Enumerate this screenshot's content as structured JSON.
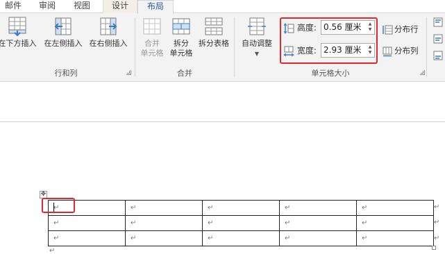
{
  "tabs": [
    {
      "label": "邮件"
    },
    {
      "label": "审阅"
    },
    {
      "label": "视图"
    },
    {
      "label": "设计"
    },
    {
      "label": "布局"
    }
  ],
  "ribbon": {
    "rows_cols": {
      "label": "行和列",
      "insert_below": "在下方插入",
      "insert_left": "在左侧插入",
      "insert_right": "在右侧插入"
    },
    "merge": {
      "label": "合并",
      "merge_cells": [
        "合并",
        "单元格"
      ],
      "split_cells": [
        "拆分",
        "单元格"
      ],
      "split_table": "拆分表格"
    },
    "cell_size": {
      "label": "单元格大小",
      "autofit": "自动调整",
      "height_label": "高度:",
      "height_value": "0.56 厘米",
      "width_label": "宽度:",
      "width_value": "2.93 厘米",
      "distribute_rows": "分布行",
      "distribute_cols": "分布列"
    }
  },
  "document": {
    "paragraph_mark": "↵",
    "rows": [
      [
        "↵",
        "↵",
        "↵",
        "↵",
        "↵"
      ],
      [
        "↵",
        "↵",
        "↵",
        "↵",
        "↵"
      ],
      [
        "↵",
        "↵",
        "↵",
        "↵",
        "↵"
      ]
    ],
    "row_end_marks": [
      "↵",
      "↵",
      "↵"
    ],
    "move_handle": "✥"
  },
  "colors": {
    "highlight": "#e0282e",
    "accent": "#2b579a",
    "icon_blue": "#3b7cc4"
  }
}
